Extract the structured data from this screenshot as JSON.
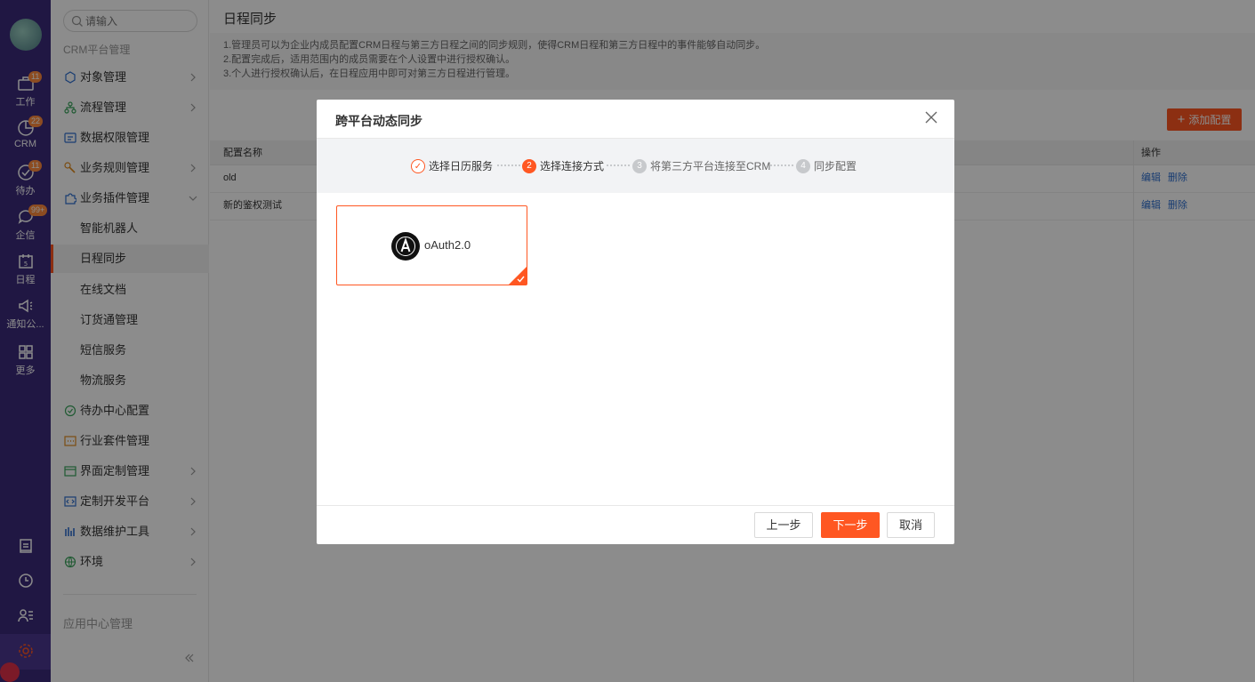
{
  "rail": {
    "items": [
      {
        "label": "工作",
        "badge": "11"
      },
      {
        "label": "CRM",
        "badge": "22"
      },
      {
        "label": "待办",
        "badge": "11"
      },
      {
        "label": "企信",
        "badge": "99+"
      },
      {
        "label": "日程",
        "badge": ""
      },
      {
        "label": "通知公...",
        "badge": ""
      },
      {
        "label": "更多",
        "badge": ""
      }
    ]
  },
  "sidebar": {
    "search_placeholder": "请输入",
    "section_title": "CRM平台管理",
    "items": [
      {
        "label": "对象管理"
      },
      {
        "label": "流程管理"
      },
      {
        "label": "数据权限管理"
      },
      {
        "label": "业务规则管理"
      },
      {
        "label": "业务插件管理"
      },
      {
        "label": "待办中心配置"
      },
      {
        "label": "行业套件管理"
      },
      {
        "label": "界面定制管理"
      },
      {
        "label": "定制开发平台"
      },
      {
        "label": "数据维护工具"
      },
      {
        "label": "环境"
      }
    ],
    "sub_items": [
      {
        "label": "智能机器人"
      },
      {
        "label": "日程同步"
      },
      {
        "label": "在线文档"
      },
      {
        "label": "订货通管理"
      },
      {
        "label": "短信服务"
      },
      {
        "label": "物流服务"
      }
    ],
    "footer_section": "应用中心管理"
  },
  "main": {
    "title": "日程同步",
    "info_lines": [
      "1.管理员可以为企业内成员配置CRM日程与第三方日程之间的同步规则，使得CRM日程和第三方日程中的事件能够自动同步。",
      "2.配置完成后，适用范围内的成员需要在个人设置中进行授权确认。",
      "3.个人进行授权确认后，在日程应用中即可对第三方日程进行管理。"
    ],
    "add_button": "添加配置",
    "table": {
      "col_name": "配置名称",
      "col_ops": "操作",
      "rows": [
        {
          "name": "old",
          "edit": "编辑",
          "delete": "删除"
        },
        {
          "name": "新的鉴权测试",
          "edit": "编辑",
          "delete": "删除"
        }
      ]
    }
  },
  "modal": {
    "title": "跨平台动态同步",
    "steps": [
      {
        "num": "",
        "label": "选择日历服务",
        "state": "done"
      },
      {
        "num": "2",
        "label": "选择连接方式",
        "state": "current"
      },
      {
        "num": "3",
        "label": "将第三方平台连接至CRM",
        "state": "pending"
      },
      {
        "num": "4",
        "label": "同步配置",
        "state": "pending"
      }
    ],
    "option": {
      "label": "oAuth2.0",
      "selected": true
    },
    "buttons": {
      "prev": "上一步",
      "next": "下一步",
      "cancel": "取消"
    }
  },
  "colors": {
    "accent": "#ff5722",
    "rail": "#3b2a7a",
    "link": "#2f6fcf"
  }
}
